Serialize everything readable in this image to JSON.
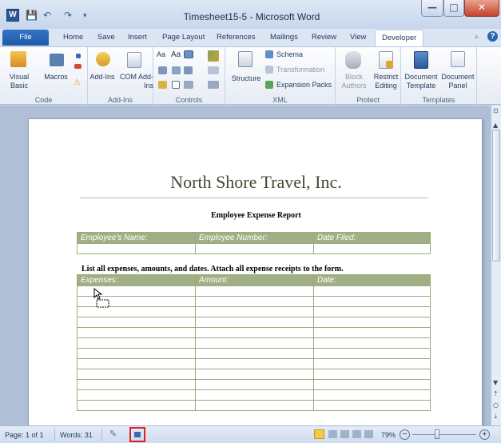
{
  "window": {
    "title": "Timesheet15-5 - Microsoft Word",
    "app_icon_letter": "W",
    "quick_access": [
      "💾",
      "↶",
      "↷",
      "▾"
    ],
    "controls": {
      "minimize": "—",
      "maximize": "□",
      "close": "✕"
    }
  },
  "tabs": [
    "File",
    "Home",
    "Save",
    "Insert",
    "Page Layout",
    "References",
    "Mailings",
    "Review",
    "View",
    "Developer"
  ],
  "active_tab": "Developer",
  "ribbon": {
    "groups": [
      {
        "label": "Code",
        "buttons": [
          "Visual Basic",
          "Macros"
        ]
      },
      {
        "label": "Add-Ins",
        "buttons": [
          "Add-Ins",
          "COM Add-Ins"
        ]
      },
      {
        "label": "Controls",
        "buttons": [
          "Aa",
          "Aa"
        ]
      },
      {
        "label": "XML",
        "buttons": [
          "Structure",
          "Schema",
          "Transformation",
          "Expansion Packs"
        ]
      },
      {
        "label": "Protect",
        "buttons": [
          "Block Authors",
          "Restrict Editing"
        ]
      },
      {
        "label": "Templates",
        "buttons": [
          "Document Template",
          "Document Panel"
        ]
      }
    ]
  },
  "document": {
    "company": "North Shore Travel, Inc.",
    "report_title": "Employee Expense Report",
    "employee_table": {
      "headers": [
        "Employee's Name:",
        "Employee Number:",
        "Date Filed:"
      ]
    },
    "instructions": "List all expenses, amounts, and dates. Attach all expense receipts to the form.",
    "expense_table": {
      "headers": [
        "Expenses:",
        "Amount:",
        "Date:"
      ],
      "empty_rows": 12
    }
  },
  "status": {
    "page": "Page: 1 of 1",
    "words": "Words: 31",
    "zoom": "79%",
    "zoom_level": 0.79
  },
  "colors": {
    "table_header": "#a1b084",
    "file_tab": "#2a64b5",
    "close_button": "#c4422a"
  }
}
